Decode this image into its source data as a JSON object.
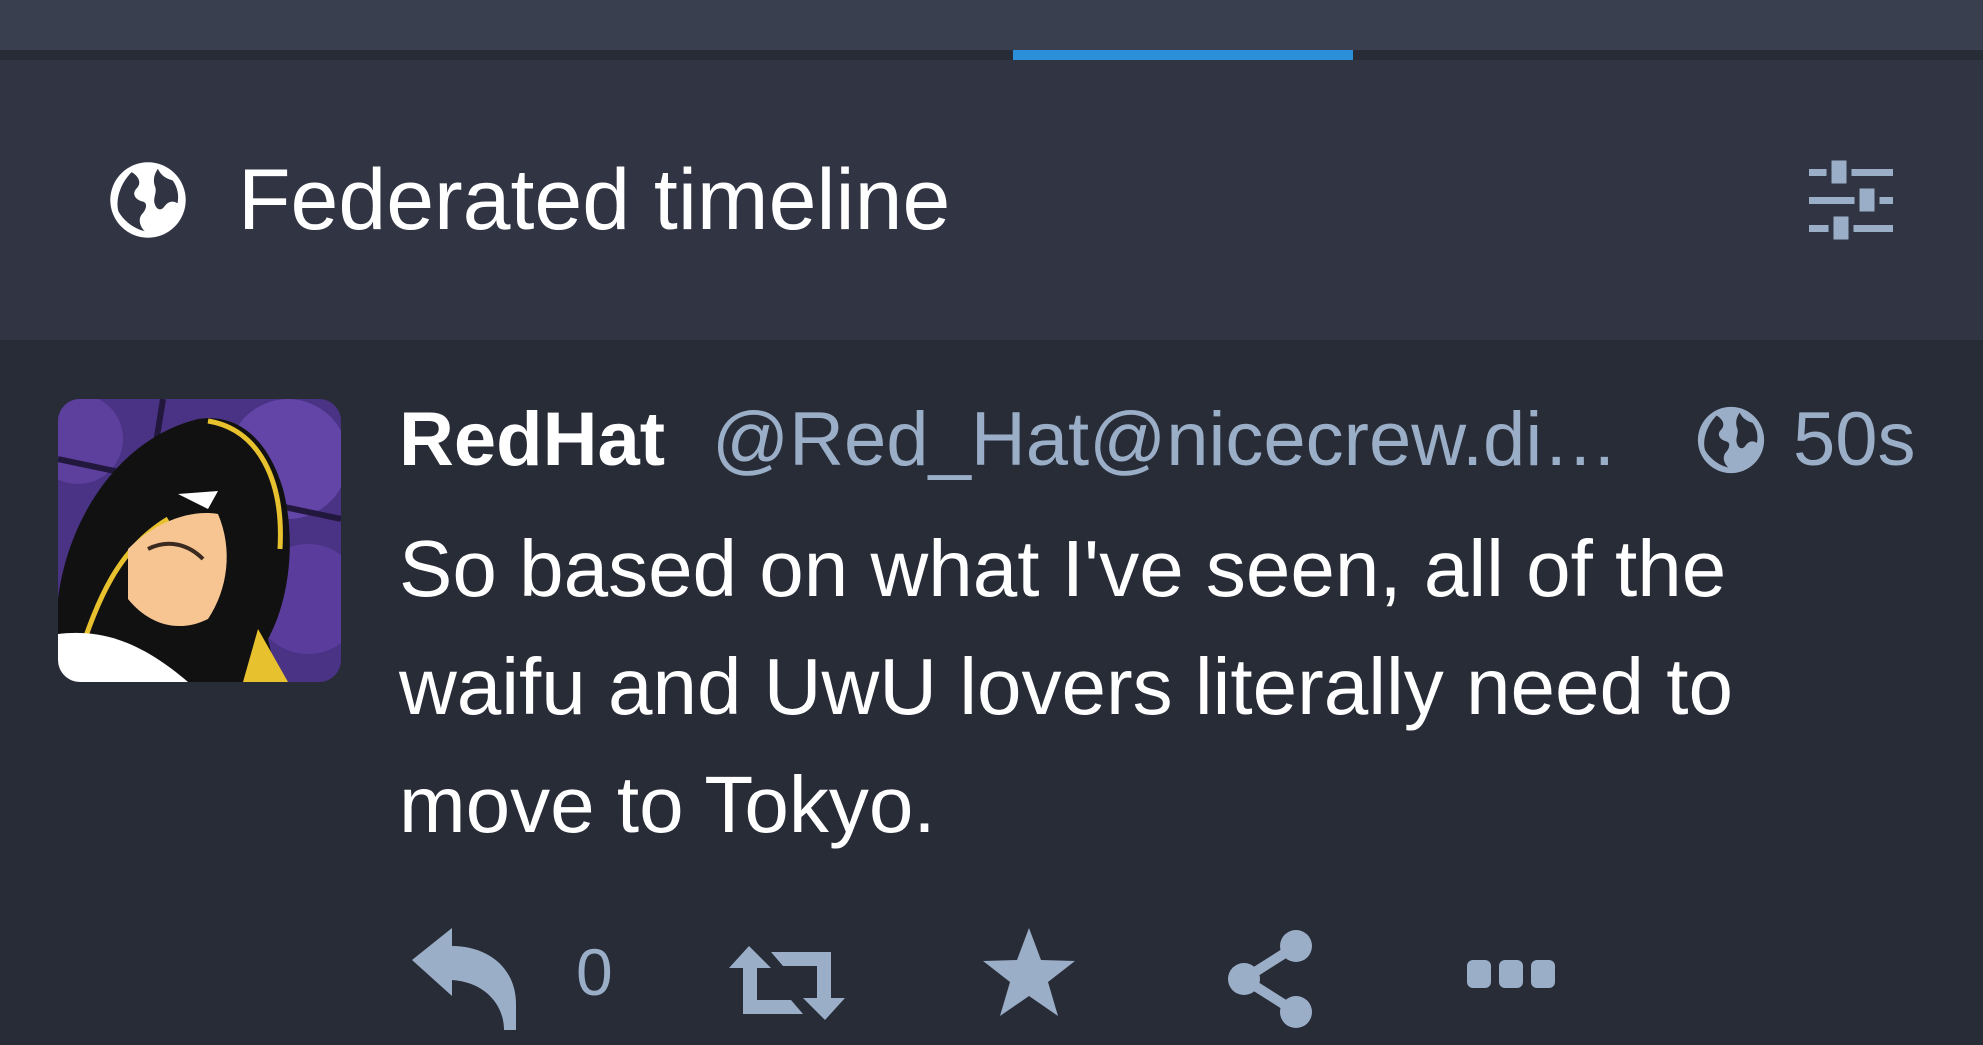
{
  "column": {
    "title": "Federated timeline",
    "icon": "globe-icon",
    "settings_icon": "sliders-icon"
  },
  "status": {
    "display_name": "RedHat",
    "handle": "@Red_Hat@nicecrew.di…",
    "visibility_icon": "globe-icon",
    "time": "50s",
    "content": "So based on what I've seen, all of the waifu and UwU lovers literally need to move to Tokyo.",
    "actions": {
      "reply_count": "0",
      "reply_icon": "reply-icon",
      "boost_icon": "retweet-icon",
      "favourite_icon": "star-icon",
      "share_icon": "share-icon",
      "more_icon": "ellipsis-icon"
    }
  },
  "colors": {
    "background": "#282c37",
    "header_background": "#313543",
    "top_strip": "#393f4f",
    "accent": "#2b90d9",
    "secondary_text": "#9baec8",
    "primary_text": "#ffffff"
  }
}
